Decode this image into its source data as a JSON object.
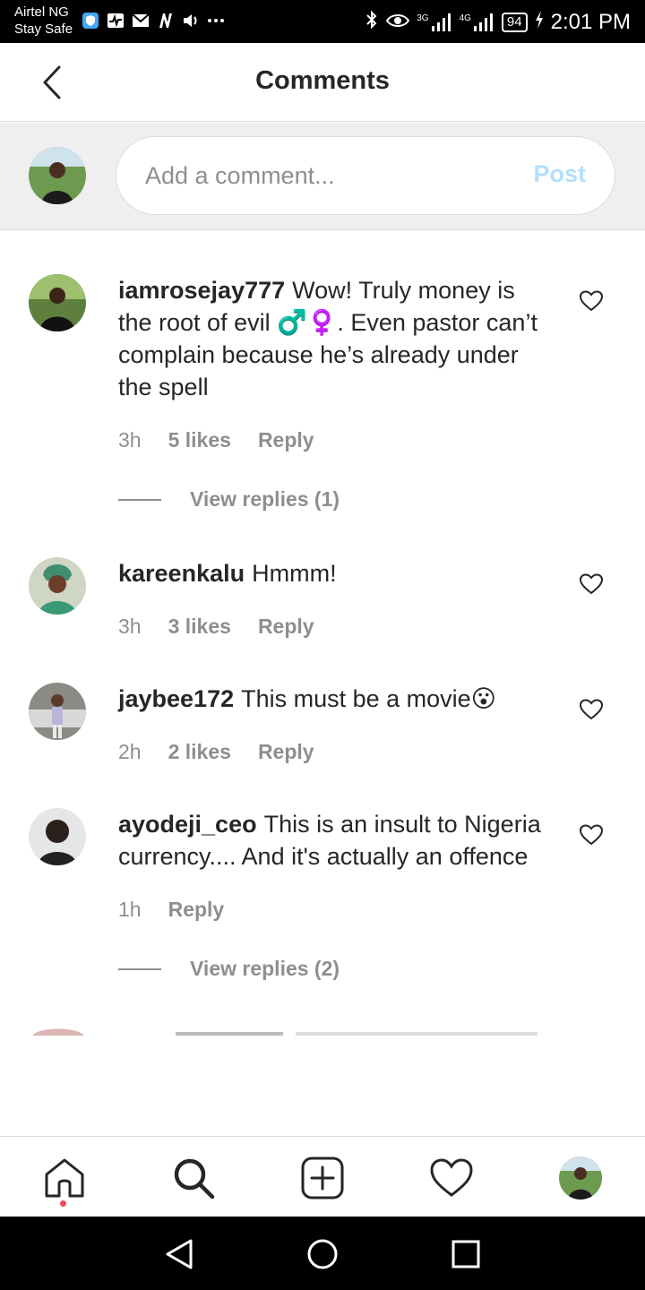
{
  "status_bar": {
    "carrier_line1": "Airtel NG",
    "carrier_line2": "Stay Safe",
    "time": "2:01 PM",
    "battery": "94",
    "network_a": "3G",
    "network_b": "4G"
  },
  "header": {
    "title": "Comments"
  },
  "composer": {
    "placeholder": "Add a comment...",
    "post_label": "Post"
  },
  "comments": [
    {
      "username": "iamrosejay777",
      "text": "Wow! Truly money is the root of evil ♂️♀️. Even pastor can’t complain because he’s already under the spell",
      "time": "3h",
      "likes": "5 likes",
      "reply": "Reply",
      "view_replies": "View replies (1)"
    },
    {
      "username": "kareenkalu",
      "text": "Hmmm!",
      "time": "3h",
      "likes": "3 likes",
      "reply": "Reply"
    },
    {
      "username": "jaybee172",
      "text": "This must be a movie😮",
      "time": "2h",
      "likes": "2 likes",
      "reply": "Reply"
    },
    {
      "username": "ayodeji_ceo",
      "text": "This is an insult to Nigeria currency.... And it's actually an offence",
      "time": "1h",
      "reply": "Reply",
      "view_replies": "View replies (2)"
    }
  ],
  "colors": {
    "accent_disabled": "#b2dffc",
    "text_primary": "#262626",
    "text_secondary": "#8e8e8e",
    "notification_dot": "#ed4956"
  },
  "icons": {
    "back": "chevron-left-icon",
    "like": "heart-outline-icon",
    "home": "home-icon",
    "search": "search-icon",
    "create": "plus-square-icon",
    "activity": "heart-icon",
    "profile": "avatar"
  }
}
